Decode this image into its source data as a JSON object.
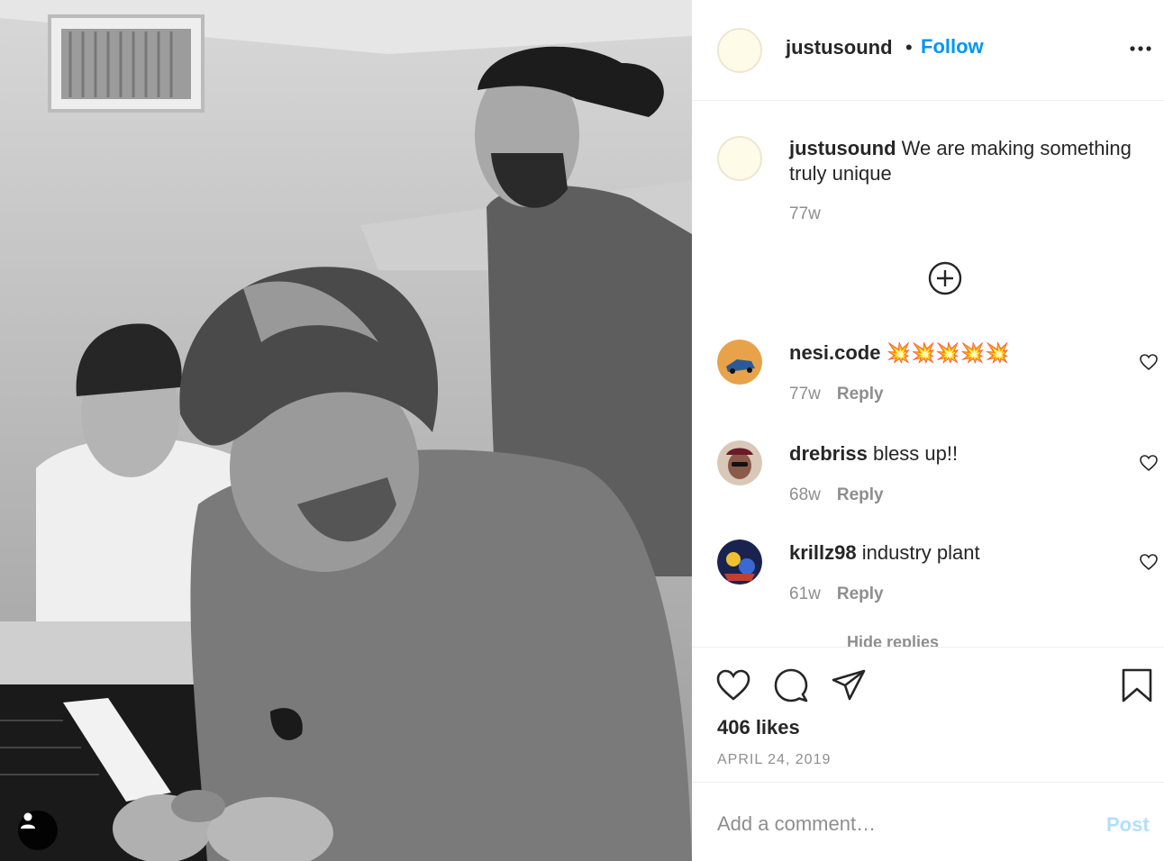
{
  "post": {
    "author": "justusound",
    "follow_label": "Follow",
    "separator": "•",
    "photo_description": "",
    "caption": "We are making something truly unique",
    "caption_time": "77w"
  },
  "comments": [
    {
      "user": "nesi.code",
      "text": "💥💥💥💥💥",
      "time": "77w",
      "reply_label": "Reply",
      "avatar_color": "#e8a24a"
    },
    {
      "user": "drebriss",
      "text": "bless up!!",
      "time": "68w",
      "reply_label": "Reply",
      "avatar_color": "#8a5a4a"
    },
    {
      "user": "krillz98",
      "text": "industry plant",
      "time": "61w",
      "reply_label": "Reply",
      "avatar_color": "#2a3a7a"
    }
  ],
  "hide_replies_label": "Hide replies",
  "actions": {
    "likes": "406 likes",
    "date": "APRIL 24, 2019"
  },
  "add_comment": {
    "placeholder": "Add a comment…",
    "post_label": "Post"
  },
  "icons": [
    "more-options-icon",
    "plus-circle-icon",
    "heart-icon",
    "comment-icon",
    "share-icon",
    "bookmark-icon",
    "person-tag-icon"
  ],
  "colors": {
    "follow": "#0095f6",
    "post_disabled": "#b2dffc",
    "secondary_text": "#8e8e8e",
    "divider": "#efefef"
  }
}
